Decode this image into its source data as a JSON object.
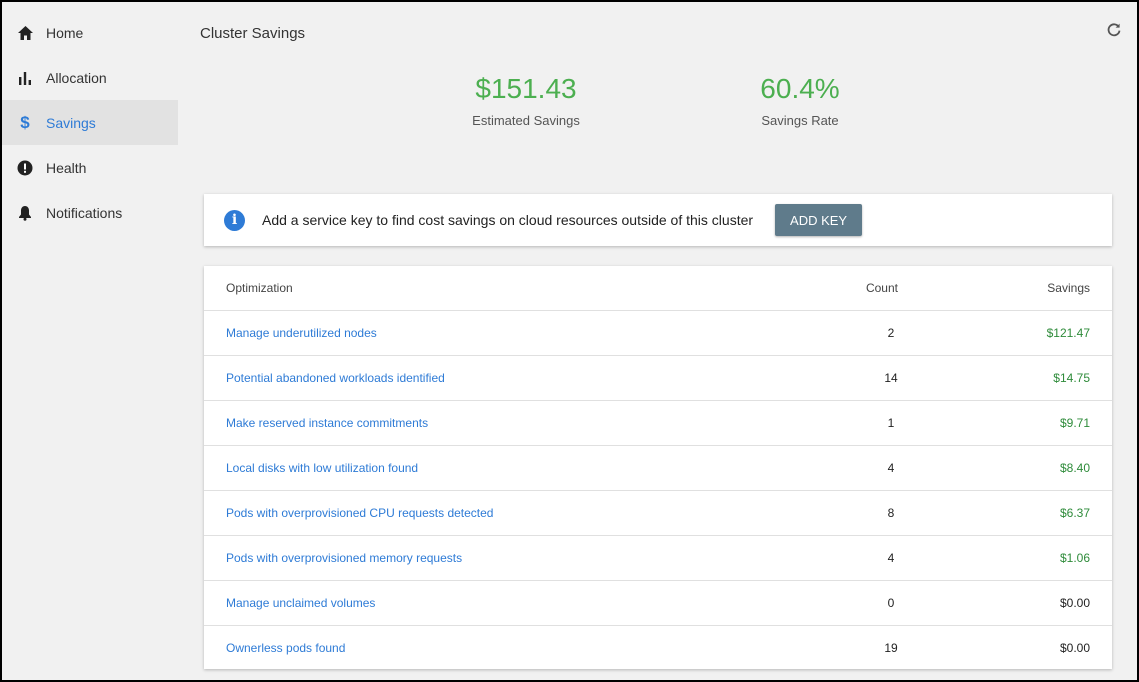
{
  "sidebar": {
    "items": [
      {
        "label": "Home",
        "icon": "home-icon",
        "active": false
      },
      {
        "label": "Allocation",
        "icon": "bar-chart-icon",
        "active": false
      },
      {
        "label": "Savings",
        "icon": "dollar-icon",
        "active": true
      },
      {
        "label": "Health",
        "icon": "alert-circle-icon",
        "active": false
      },
      {
        "label": "Notifications",
        "icon": "bell-icon",
        "active": false
      }
    ]
  },
  "header": {
    "title": "Cluster Savings",
    "refresh_icon": "refresh-icon"
  },
  "stats": {
    "estimated_savings": {
      "value": "$151.43",
      "label": "Estimated Savings"
    },
    "savings_rate": {
      "value": "60.4%",
      "label": "Savings Rate"
    }
  },
  "banner": {
    "icon": "info-icon",
    "text": "Add a service key to find cost savings on cloud resources outside of this cluster",
    "button_label": "ADD KEY"
  },
  "table": {
    "headers": {
      "optimization": "Optimization",
      "count": "Count",
      "savings": "Savings"
    },
    "rows": [
      {
        "optimization": "Manage underutilized nodes",
        "count": "2",
        "savings": "$121.47"
      },
      {
        "optimization": "Potential abandoned workloads identified",
        "count": "14",
        "savings": "$14.75"
      },
      {
        "optimization": "Make reserved instance commitments",
        "count": "1",
        "savings": "$9.71"
      },
      {
        "optimization": "Local disks with low utilization found",
        "count": "4",
        "savings": "$8.40"
      },
      {
        "optimization": "Pods with overprovisioned CPU requests detected",
        "count": "8",
        "savings": "$6.37"
      },
      {
        "optimization": "Pods with overprovisioned memory requests",
        "count": "4",
        "savings": "$1.06"
      },
      {
        "optimization": "Manage unclaimed volumes",
        "count": "0",
        "savings": "$0.00"
      },
      {
        "optimization": "Ownerless pods found",
        "count": "19",
        "savings": "$0.00"
      }
    ]
  },
  "colors": {
    "accent": "#2e7bd6",
    "stat_green": "#4caf50",
    "savings_green": "#2e8b3a",
    "button": "#5f7b8b"
  }
}
